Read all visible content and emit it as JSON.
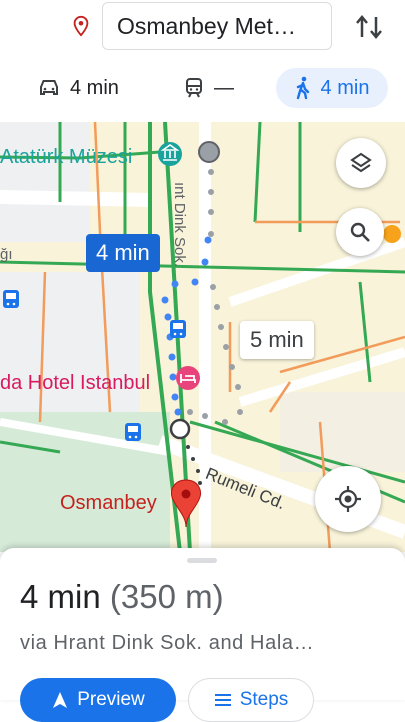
{
  "header": {
    "destination": "Osmanbey Met…",
    "destination_icon": "location-pin-icon",
    "swap_icon": "swap-vertical-icon"
  },
  "modes": {
    "drive": {
      "icon": "car-icon",
      "label": "4 min"
    },
    "transit": {
      "icon": "train-icon",
      "label": "—"
    },
    "walk": {
      "icon": "walking-person-icon",
      "label": "4 min",
      "selected": true
    }
  },
  "map": {
    "labels": {
      "museum": "Atatürk Müzesi",
      "street_top": "ınt Dink Sok.",
      "fragment_left": "ğı",
      "hotel": "da Hotel Istanbul",
      "street_bottom": "Rumeli Cd.",
      "destination": "Osmanbey"
    },
    "route_chips": {
      "selected": "4 min",
      "alternate": "5 min"
    },
    "buttons": {
      "layers_icon": "layers-icon",
      "search_icon": "search-icon",
      "locate_icon": "my-location-icon"
    },
    "colors": {
      "route_blue": "#4285f4",
      "alt_route_gray": "#9aa0a6",
      "road_green": "#34a853",
      "road_orange": "#f29b5b",
      "poi_pink": "#e8437a",
      "poi_teal": "#1aa39c"
    }
  },
  "sheet": {
    "duration": "4 min",
    "distance": "(350 m)",
    "via": "via Hrant Dink Sok. and Hala…",
    "preview_label": "Preview",
    "steps_label": "Steps"
  }
}
